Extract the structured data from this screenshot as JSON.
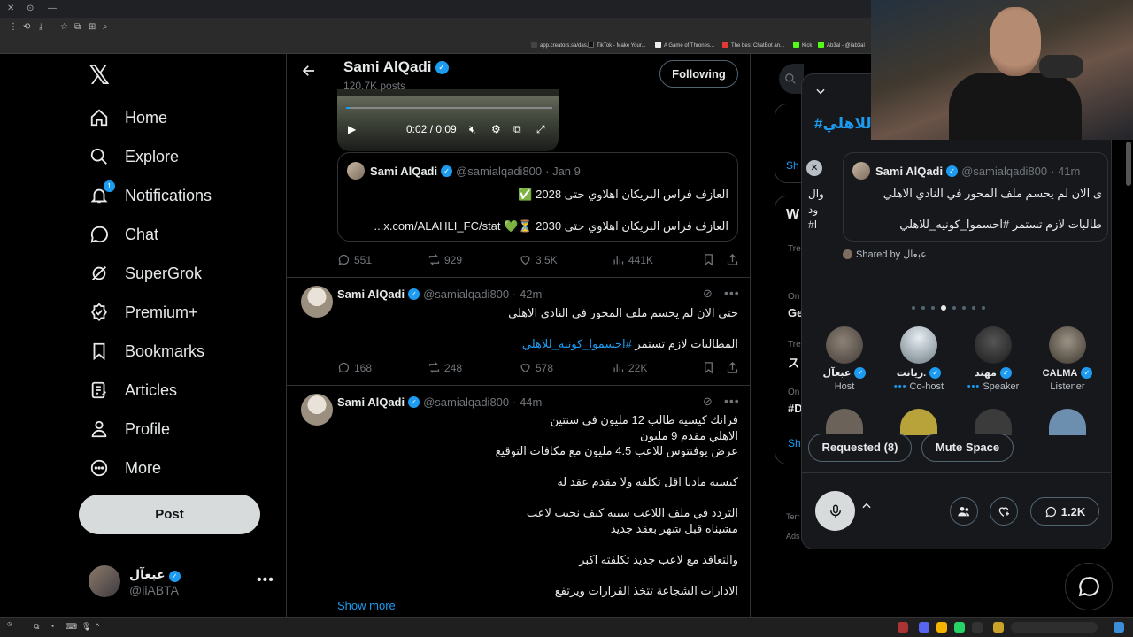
{
  "browser": {
    "bookmarks": [
      "app.creators.sa/das...",
      "TikTok - Make Your...",
      "A Game of Thrones...",
      "The best ChatBot an...",
      "Kick",
      "Ab3al - @iab3al"
    ]
  },
  "nav": {
    "items": [
      {
        "label": "Home",
        "icon": "home-icon"
      },
      {
        "label": "Explore",
        "icon": "search-icon"
      },
      {
        "label": "Notifications",
        "icon": "bell-icon",
        "badge": "1"
      },
      {
        "label": "Chat",
        "icon": "chat-icon"
      },
      {
        "label": "SuperGrok",
        "icon": "grok-icon"
      },
      {
        "label": "Premium+",
        "icon": "premium-icon"
      },
      {
        "label": "Bookmarks",
        "icon": "bookmark-icon"
      },
      {
        "label": "Articles",
        "icon": "articles-icon"
      },
      {
        "label": "Profile",
        "icon": "person-icon"
      },
      {
        "label": "More",
        "icon": "more-circle-icon"
      }
    ],
    "post_label": "Post",
    "account": {
      "name": "عبعآل",
      "handle": "@iiABTA"
    }
  },
  "header": {
    "name": "Sami AlQadi",
    "posts": "120.7K posts",
    "follow_label": "Following"
  },
  "video": {
    "time": "0:02 / 0:09"
  },
  "quote": {
    "name": "Sami AlQadi",
    "handle": "@samialqadi800",
    "date": "· Jan 9",
    "line1": "العازف فراس البريكان اهلاوي حتى 2028 ✅",
    "line2": "العازف فراس البريكان اهلاوي حتى 2030 ⏳💚 x.com/ALAHLI_FC/stat..."
  },
  "tweet0_actions": {
    "replies": "551",
    "reposts": "929",
    "likes": "3.5K",
    "views": "441K"
  },
  "tweet1": {
    "name": "Sami AlQadi",
    "handle": "@samialqadi800",
    "time": "· 42m",
    "line1": "حتى الان لم يحسم ملف المحور في النادي الاهلي",
    "line2_text": "المطالبات لازم تستمر ",
    "line2_tag": "#احسموا_كونيه_للاهلي",
    "replies": "168",
    "reposts": "248",
    "likes": "578",
    "views": "22K"
  },
  "tweet2": {
    "name": "Sami AlQadi",
    "handle": "@samialqadi800",
    "time": "· 44m",
    "lines": [
      "فرانك كيسيه طالب 12 مليون في سنتين",
      "الاهلي مقدم 9 مليون",
      "عرض يوفنتوس للاعب 4.5 مليون مع مكافات التوقيع",
      "كيسيه ماديا اقل تكلفه ولا مقدم عقد له",
      "التردد في ملف اللاعب سببه كيف نجيب لاعب",
      "مشيناه قبل شهر بعقد جديد",
      "والتعاقد مع لاعب جديد تكلفته اكبر",
      "الادارات الشجاعة تتخذ القرارات ويرتفع"
    ],
    "show_more": "Show more"
  },
  "right_column": {
    "show_fragment_1": "Sh",
    "what_fragment": "W",
    "trend_fragments": [
      "Tre",
      "On",
      "Ge",
      "Tre",
      "ス",
      "On",
      "#D"
    ],
    "show_fragment_2": "Sh",
    "terms_fragment": "Terr",
    "ads_fragment": "Ads"
  },
  "spaces": {
    "title": "للاهلي#",
    "left_fragments": [
      "وال",
      "ود",
      "#ا"
    ],
    "card": {
      "name": "Sami AlQadi",
      "handle": "@samialqadi800",
      "time": "· 41m",
      "line1": "ى الان لم يحسم ملف المحور في النادي الاهلي",
      "line2": "طالبات لازم تستمر #احسموا_كونيه_للاهلي"
    },
    "shared_by": "Shared by عبعآل",
    "participants": [
      {
        "name": "عبعآل",
        "role": "Host",
        "dots": ""
      },
      {
        "name": "ريانت.",
        "role": "Co-host",
        "dots": "•••"
      },
      {
        "name": "مهند",
        "role": "Speaker",
        "dots": "•••"
      },
      {
        "name": "CALMA",
        "role": "Listener",
        "dots": ""
      }
    ],
    "requested_label": "Requested (8)",
    "mute_label": "Mute Space",
    "comments_count": "1.2K"
  },
  "colors": {
    "accent": "#1d9bf0",
    "bg": "#000000",
    "panel": "#16181c",
    "border": "#2f3336",
    "muted": "#71767b"
  }
}
